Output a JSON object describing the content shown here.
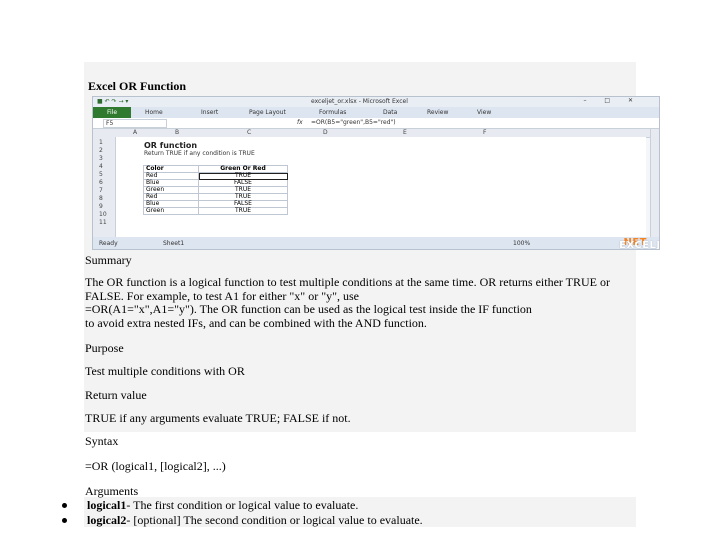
{
  "title": "Excel OR Function",
  "excel": {
    "window_title": "exceljet_or.xlsx - Microsoft Excel",
    "quick_access": "■ ↶ ↷ → ▾",
    "window_controls": "– □ ✕",
    "file_tab": "File",
    "ribbon_tabs": [
      "Home",
      "Insert",
      "Page Layout",
      "Formulas",
      "Data",
      "Review",
      "View"
    ],
    "name_box": "F5",
    "fx": "fx",
    "formula": "=OR(B5=\"green\",B5=\"red\")",
    "columns": [
      "A",
      "B",
      "C",
      "D",
      "E",
      "F"
    ],
    "rows": [
      "1",
      "2",
      "3",
      "4",
      "5",
      "6",
      "7",
      "8",
      "9",
      "10",
      "11"
    ],
    "sheet_heading": "OR function",
    "sheet_subheading": "Return TRUE if any condition is TRUE",
    "table": {
      "headers": [
        "Color",
        "Green Or Red"
      ],
      "rows": [
        [
          "Red",
          "TRUE"
        ],
        [
          "Blue",
          "FALSE"
        ],
        [
          "Green",
          "TRUE"
        ],
        [
          "Red",
          "TRUE"
        ],
        [
          "Blue",
          "FALSE"
        ],
        [
          "Green",
          "TRUE"
        ]
      ]
    },
    "status_ready": "Ready",
    "sheet_tab": "Sheet1",
    "zoom": "100%",
    "logo_text": "EXCELJET",
    "logo_suffix": ".NET"
  },
  "summary_heading": "Summary",
  "summary_lines": [
    "The OR function is a logical function to test multiple conditions at the same time. OR returns either TRUE or",
    "FALSE. For example, to test A1 for either \"x\" or \"y\", use",
    "=OR(A1=\"x\",A1=\"y\"). The OR function can be used as the logical test inside the IF function",
    "to avoid extra nested IFs, and can be combined with the AND function."
  ],
  "purpose_heading": "Purpose",
  "purpose_text": "Test multiple conditions with OR",
  "return_heading": "Return value",
  "return_text": "TRUE if any arguments evaluate TRUE; FALSE if not.",
  "syntax_heading": "Syntax",
  "syntax_text": "=OR (logical1, [logical2], ...)",
  "arguments_heading": "Arguments",
  "arguments": [
    {
      "name": "logical1",
      "desc": " - The first condition or logical value to evaluate."
    },
    {
      "name": "logical2",
      "desc": " - [optional] The second condition or logical value to evaluate."
    }
  ]
}
